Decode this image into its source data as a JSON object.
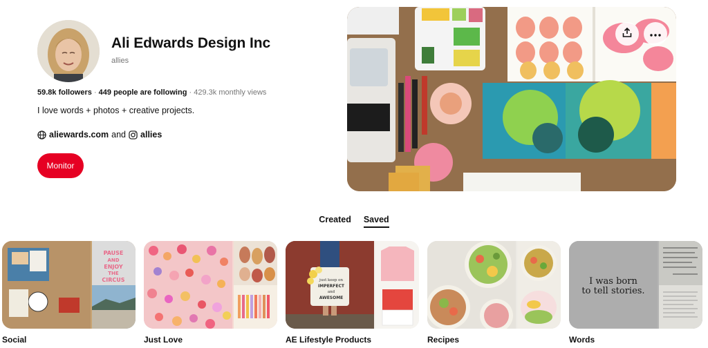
{
  "profile": {
    "name": "Ali Edwards Design Inc",
    "handle": "allies",
    "followers": "59.8k followers",
    "following": "449 people are following",
    "views": "429.3k monthly views",
    "bio": "I love words + photos + creative projects.",
    "website": "aliewards.com",
    "and_text": "and",
    "instagram": "allies",
    "monitor_label": "Monitor"
  },
  "tabs": [
    {
      "label": "Created",
      "active": false
    },
    {
      "label": "Saved",
      "active": true
    }
  ],
  "boards": [
    {
      "title": "Social"
    },
    {
      "title": "Just Love"
    },
    {
      "title": "AE Lifestyle Products"
    },
    {
      "title": "Recipes"
    },
    {
      "title": "Words"
    }
  ],
  "board_art": {
    "pause_text_1": "PAUSE",
    "pause_text_2": "AND",
    "pause_text_3": "ENJOY",
    "pause_text_4": "THE",
    "pause_text_5": "CIRCUS",
    "tote_text_1": "just keep on",
    "tote_text_2": "IMPERFECT",
    "tote_text_3": "and",
    "tote_text_4": "AWESOME",
    "born_line_1": "I was born",
    "born_line_2": "to tell stories."
  },
  "colors": {
    "accent": "#e60023",
    "muted": "#767676",
    "text": "#111111"
  },
  "icons": {
    "share": "upload-icon",
    "more": "ellipsis-icon",
    "globe": "globe-icon",
    "instagram": "instagram-icon"
  }
}
